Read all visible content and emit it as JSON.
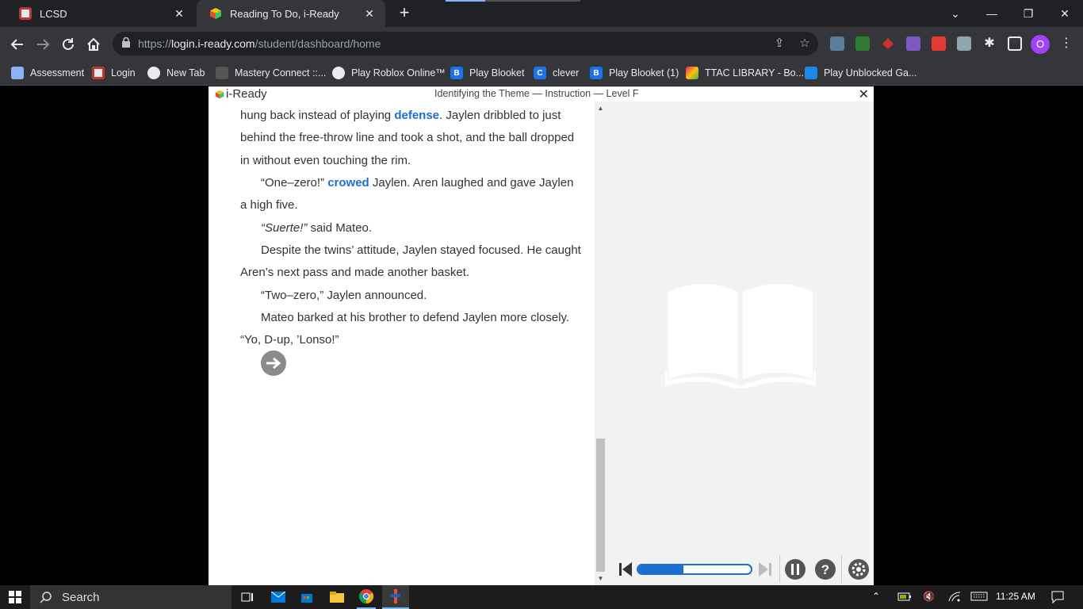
{
  "browser": {
    "tabs": [
      {
        "title": "LCSD",
        "active": false,
        "favicon_color": "#c0392b"
      },
      {
        "title": "Reading To Do, i-Ready",
        "active": true,
        "favicon_color": "#2ecc71"
      }
    ],
    "new_tab_glyph": "+",
    "url_prefix": "https://",
    "url_host": "login.i-ready.com",
    "url_path": "/student/dashboard/home",
    "profile_initial": "O",
    "bookmarks": [
      {
        "label": "Assessment",
        "icon": "doc-icon",
        "color": "#8ab4f8"
      },
      {
        "label": "Login",
        "icon": "lcsd-icon",
        "color": "#c0392b"
      },
      {
        "label": "New Tab",
        "icon": "chrome-icon",
        "color": "#e8eaed"
      },
      {
        "label": "Mastery Connect ::...",
        "icon": "mastery-icon",
        "color": "#555"
      },
      {
        "label": "Play Roblox Online™",
        "icon": "globe-icon",
        "color": "#e8eaed"
      },
      {
        "label": "Play Blooket",
        "icon": "blooket-icon",
        "color": "#1a73e8"
      },
      {
        "label": "clever",
        "icon": "clever-icon",
        "color": "#1a73e8"
      },
      {
        "label": "Play Blooket (1)",
        "icon": "blooket-icon",
        "color": "#1a73e8"
      },
      {
        "label": "TTAC LIBRARY - Bo...",
        "icon": "ttac-icon",
        "color": "#e91e63"
      },
      {
        "label": "Play Unblocked Ga...",
        "icon": "unblocked-icon",
        "color": "#1e88e5"
      }
    ]
  },
  "app": {
    "brand": "i-Ready",
    "lesson_title": "Identifying the Theme  — Instruction — Level F",
    "close_glyph": "✕",
    "passage": [
      {
        "indent": false,
        "segments": [
          {
            "t": "hung back instead of playing "
          },
          {
            "t": "defense",
            "vocab": true
          },
          {
            "t": ". Jaylen dribbled to just behind the free-throw line and took a shot, and the ball dropped in without even touching the rim."
          }
        ]
      },
      {
        "indent": true,
        "segments": [
          {
            "t": "“One–zero!” "
          },
          {
            "t": "crowed",
            "vocab": true
          },
          {
            "t": " Jaylen. Aren laughed and gave Jaylen a high five."
          }
        ]
      },
      {
        "indent": true,
        "segments": [
          {
            "t": "“Suerte!”",
            "italic": true
          },
          {
            "t": " said Mateo."
          }
        ]
      },
      {
        "indent": true,
        "segments": [
          {
            "t": "Despite the twins’ attitude, Jaylen stayed focused. He caught Aren’s next pass and made another basket."
          }
        ]
      },
      {
        "indent": true,
        "segments": [
          {
            "t": "“Two–zero,” Jaylen announced."
          }
        ]
      },
      {
        "indent": true,
        "segments": [
          {
            "t": "Mateo barked at his brother to defend Jaylen more closely. “Yo, D-up, ’Lonso!”"
          }
        ]
      }
    ],
    "progress_fraction": 0.4,
    "accent_color": "#1a6fd1"
  },
  "taskbar": {
    "search_label": "Search",
    "clock": "11:25 AM"
  }
}
